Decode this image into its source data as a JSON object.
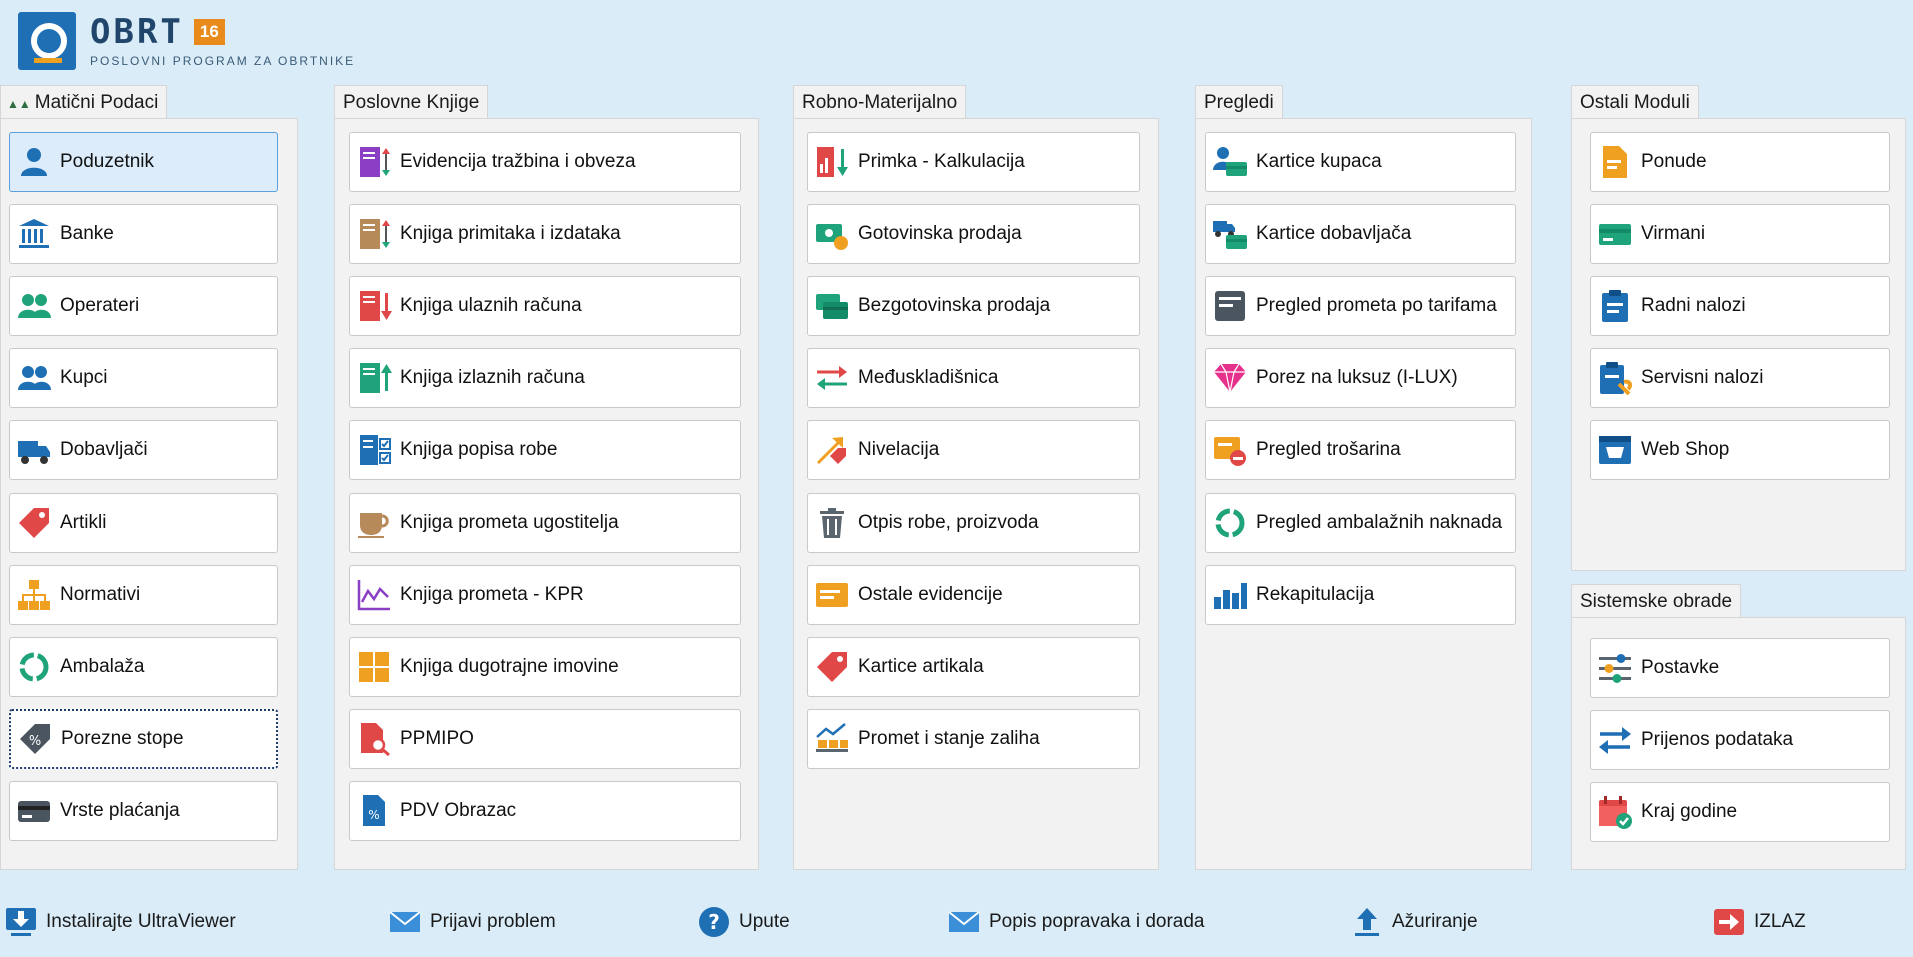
{
  "app": {
    "name": "OBRT",
    "version": "16",
    "subtitle": "POSLOVNI PROGRAM ZA OBRTNIKE"
  },
  "panels": {
    "maticni": {
      "title": "Matični Podaci",
      "items": [
        "Poduzetnik",
        "Banke",
        "Operateri",
        "Kupci",
        "Dobavljači",
        "Artikli",
        "Normativi",
        "Ambalaža",
        "Porezne stope",
        "Vrste plaćanja"
      ]
    },
    "poslovne": {
      "title": "Poslovne Knjige",
      "items": [
        "Evidencija tražbina i obveza",
        "Knjiga primitaka i izdataka",
        "Knjiga ulaznih računa",
        "Knjiga izlaznih računa",
        "Knjiga popisa robe",
        "Knjiga prometa ugostitelja",
        "Knjiga prometa - KPR",
        "Knjiga dugotrajne imovine",
        "PPMIPO",
        "PDV Obrazac"
      ]
    },
    "robno": {
      "title": "Robno-Materijalno",
      "items": [
        "Primka - Kalkulacija",
        "Gotovinska prodaja",
        "Bezgotovinska prodaja",
        "Međuskladišnica",
        "Nivelacija",
        "Otpis robe, proizvoda",
        "Ostale evidencije",
        "Kartice artikala",
        "Promet i stanje zaliha"
      ]
    },
    "pregledi": {
      "title": "Pregledi",
      "items": [
        "Kartice kupaca",
        "Kartice dobavljača",
        "Pregled prometa po tarifama",
        "Porez na luksuz (I-LUX)",
        "Pregled trošarina",
        "Pregled ambalažnih naknada",
        "Rekapitulacija"
      ]
    },
    "ostali": {
      "title": "Ostali Moduli",
      "items": [
        "Ponude",
        "Virmani",
        "Radni nalozi",
        "Servisni nalozi",
        "Web Shop"
      ]
    },
    "sistemske": {
      "title": "Sistemske obrade",
      "items": [
        "Postavke",
        "Prijenos podataka",
        "Kraj godine"
      ]
    }
  },
  "bottom": {
    "ultraviewer": "Instalirajte UltraViewer",
    "problem": "Prijavi problem",
    "upute": "Upute",
    "popis": "Popis popravaka i dorada",
    "azuriranje": "Ažuriranje",
    "izlaz": "IZLAZ"
  },
  "colors": {
    "background": "#d9ecf8",
    "panel": "#f2f2f2",
    "selected": "#dcecfb",
    "brand": "#1f6fb5",
    "accent": "#e88a1c"
  }
}
